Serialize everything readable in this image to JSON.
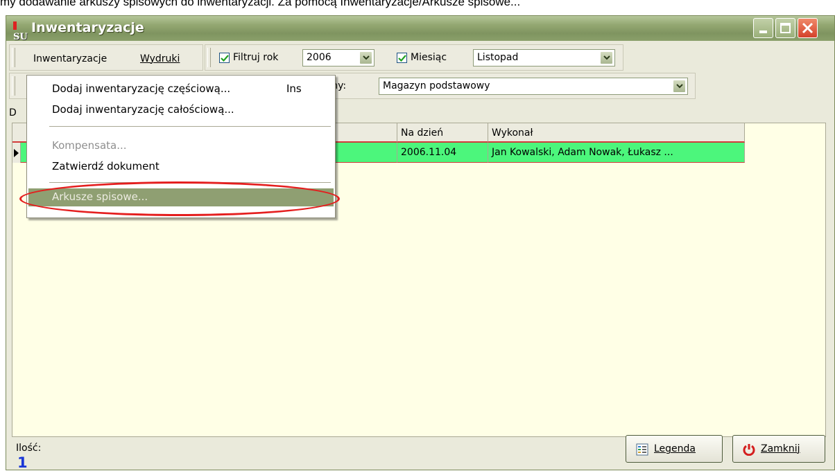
{
  "caption": "my dodawanie arkuszy spisowych do inwentaryzacji. Za pomocą Inwentaryzacje/Arkusze spisowe...",
  "window": {
    "app_icon": "SU",
    "title": "Inwentaryzacje"
  },
  "menubar": {
    "items": [
      "Inwentaryzacje",
      "Wydruki"
    ]
  },
  "filters": {
    "year_checkbox_label": "Filtruj rok",
    "year_checked": true,
    "year_value": "2006",
    "month_checkbox_label": "Miesiąc",
    "month_checked": true,
    "month_value": "Listopad",
    "warehouse_label": "azyny:",
    "warehouse_value": "Magazyn podstawowy"
  },
  "left_fragment": "D",
  "table": {
    "columns": [
      "Na dzień",
      "Wykonał"
    ],
    "rows": [
      {
        "na_dzien": "2006.11.04",
        "wykonal": "Jan Kowalski, Adam Nowak, Łukasz ..."
      }
    ],
    "row_color": "#4cf67c"
  },
  "dropdown": {
    "items": [
      {
        "label": "Dodaj inwentaryzację częściową...",
        "shortcut": "Ins",
        "disabled": false
      },
      {
        "label": "Dodaj inwentaryzację całościową...",
        "disabled": false
      },
      {
        "label": "Kompensata...",
        "disabled": true
      },
      {
        "label": "Zatwierdź dokument",
        "disabled": false
      },
      {
        "label": "Arkusze spisowe...",
        "disabled": false,
        "highlighted": true
      }
    ]
  },
  "status": {
    "count_label": "Ilość:",
    "count_value": "1"
  },
  "buttons": {
    "legend": "Legenda",
    "close": "Zamknij"
  },
  "colors": {
    "accent_highlight": "#8f9f72",
    "annotation_ring": "#e41e1e",
    "count_text": "#1a37d6"
  }
}
